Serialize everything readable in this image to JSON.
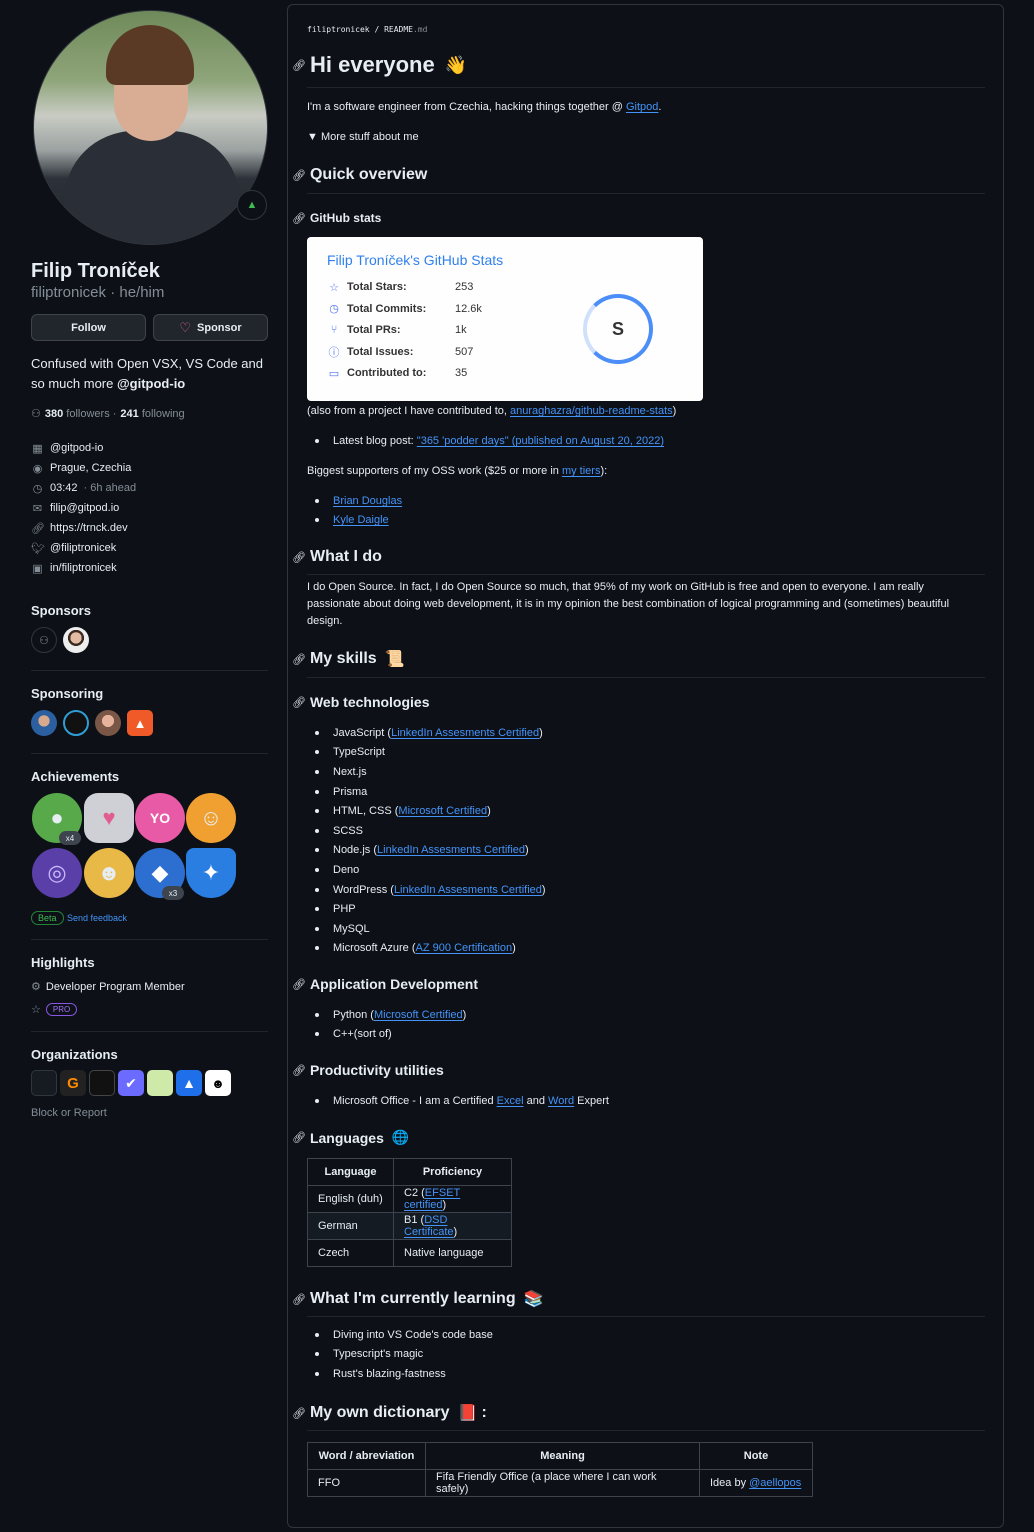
{
  "profile": {
    "name": "Filip Troníček",
    "login": "filiptronicek",
    "pronouns": "he/him",
    "login_line": "filiptronicek · he/him",
    "follow_label": "Follow",
    "sponsor_label": "Sponsor",
    "bio_text": "Confused with Open VSX, VS Code and so much more ",
    "bio_org": "@gitpod-io",
    "followers_count": "380",
    "followers_label": "followers ·",
    "following_count": "241",
    "following_label": "following",
    "details": [
      {
        "icon": "organization-icon",
        "text": "@gitpod-io"
      },
      {
        "icon": "location-icon",
        "text": "Prague, Czechia"
      },
      {
        "icon": "clock-icon",
        "text": "03:42",
        "extra": "· 6h ahead"
      },
      {
        "icon": "mail-icon",
        "text": "filip@gitpod.io"
      },
      {
        "icon": "link-icon",
        "text": "https://trnck.dev"
      },
      {
        "icon": "twitter-icon",
        "text": "@filiptronicek"
      },
      {
        "icon": "linkedin-icon",
        "text": "in/filiptronicek"
      }
    ],
    "sections": {
      "sponsors": "Sponsors",
      "sponsoring": "Sponsoring",
      "achievements": "Achievements",
      "highlights": "Highlights",
      "organizations": "Organizations"
    },
    "achievement_counts": [
      "x4",
      "x3"
    ],
    "beta_label": "Beta",
    "feedback_label": "Send feedback",
    "highlight_member": "Developer Program Member",
    "highlight_pro": "PRO",
    "block_label": "Block or Report",
    "colors": {
      "accent": "#4493f8",
      "background": "#0d1117",
      "border": "#30363d",
      "muted": "#848d97",
      "sponsor_heart": "#db61a2",
      "green": "#3fb950"
    }
  },
  "readme": {
    "breadcrumb_user": "filiptronicek",
    "breadcrumb_sep": " / ",
    "breadcrumb_file": "README",
    "breadcrumb_ext": ".md",
    "h_hi": "Hi everyone",
    "h_hi_emoji": "👋",
    "intro_text": "I'm a software engineer from Czechia, hacking things together @ ",
    "intro_link": "Gitpod",
    "intro_end": ".",
    "details_summary": "More stuff about me",
    "h_overview": "Quick overview",
    "h_stats": "GitHub stats",
    "stats": {
      "title": "Filip Troníček's GitHub Stats",
      "rows": [
        {
          "icon": "star-icon",
          "label": "Total Stars:",
          "value": "253"
        },
        {
          "icon": "history-icon",
          "label": "Total Commits:",
          "value": "12.6k"
        },
        {
          "icon": "pull-request-icon",
          "label": "Total PRs:",
          "value": "1k"
        },
        {
          "icon": "issue-icon",
          "label": "Total Issues:",
          "value": "507"
        },
        {
          "icon": "repo-icon",
          "label": "Contributed to:",
          "value": "35"
        }
      ],
      "rank": "S"
    },
    "stats_note_text": "(also from a project I have contributed to, ",
    "stats_note_link": "anuraghazra/github-readme-stats",
    "stats_note_end": ")",
    "blog_text": "Latest blog post: ",
    "blog_link": "\"365 'podder days\" (published on August 20, 2022)",
    "supporters_text": "Biggest supporters of my OSS work ($25 or more in ",
    "supporters_link": "my tiers",
    "supporters_end": "):",
    "supporters": [
      "Brian Douglas",
      "Kyle Daigle"
    ],
    "h_whatido": "What I do",
    "whatido_text": "I do Open Source. In fact, I do Open Source so much, that 95% of my work on GitHub is free and open to everyone. I am really passionate about doing web development, it is in my opinion the best combination of logical programming and (sometimes) beautiful design.",
    "h_skills": "My skills",
    "h_skills_emoji": "📜",
    "h_web": "Web technologies",
    "web_skills": [
      {
        "name": "JavaScript",
        "link": "LinkedIn Assesments Certified"
      },
      {
        "name": "TypeScript",
        "link": ""
      },
      {
        "name": "Next.js",
        "link": ""
      },
      {
        "name": "Prisma",
        "link": ""
      },
      {
        "name": "HTML, CSS",
        "link": "Microsoft Certified"
      },
      {
        "name": "SCSS",
        "link": ""
      },
      {
        "name": "Node.js",
        "link": "LinkedIn Assesments Certified"
      },
      {
        "name": "Deno",
        "link": ""
      },
      {
        "name": "WordPress",
        "link": "LinkedIn Assesments Certified"
      },
      {
        "name": "PHP",
        "link": ""
      },
      {
        "name": "MySQL",
        "link": ""
      },
      {
        "name": "Microsoft Azure",
        "link": "AZ 900 Certification"
      }
    ],
    "h_appdev": "Application Development",
    "app_skills": [
      {
        "name": "Python",
        "link": "Microsoft Certified",
        "suffix": ""
      },
      {
        "name": "C++",
        "link": "",
        "suffix": " (sort of)"
      }
    ],
    "h_productivity": "Productivity utilities",
    "prod_text": "Microsoft Office - I am a Certified ",
    "prod_link1": "Excel",
    "prod_and": " and ",
    "prod_link2": "Word",
    "prod_end": " Expert",
    "h_languages": "Languages",
    "h_languages_emoji": "🌐",
    "lang_table": {
      "headers": [
        "Language",
        "Proficiency"
      ],
      "rows": [
        {
          "language": "English (duh)",
          "level": "C2",
          "link": "EFSET certified"
        },
        {
          "language": "German",
          "level": "B1",
          "link": "DSD Certificate"
        },
        {
          "language": "Czech",
          "level": "Native language",
          "link": ""
        }
      ]
    },
    "h_learning": "What I'm currently learning",
    "h_learning_emoji": "📚",
    "learning": [
      "Diving into VS Code's code base",
      "Typescript's magic",
      "Rust's blazing-fastness"
    ],
    "h_dictionary": "My own dictionary",
    "h_dictionary_emoji": "📕",
    "h_dictionary_end": ":",
    "dict_table": {
      "headers": [
        "Word / abreviation",
        "Meaning",
        "Note"
      ],
      "rows": [
        {
          "word": "FFO",
          "meaning": "Fifa Friendly Office (a place where I can work safely)",
          "note_text": "Idea by ",
          "note_link": "@aellopos"
        }
      ]
    }
  }
}
